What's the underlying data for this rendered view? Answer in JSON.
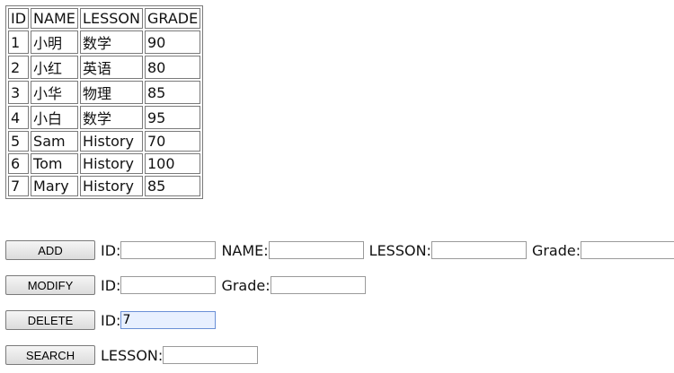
{
  "table": {
    "headers": [
      "ID",
      "NAME",
      "LESSON",
      "GRADE"
    ],
    "rows": [
      [
        "1",
        "小明",
        "数学",
        "90"
      ],
      [
        "2",
        "小红",
        "英语",
        "80"
      ],
      [
        "3",
        "小华",
        "物理",
        "85"
      ],
      [
        "4",
        "小白",
        "数学",
        "95"
      ],
      [
        "5",
        "Sam",
        "History",
        "70"
      ],
      [
        "6",
        "Tom",
        "History",
        "100"
      ],
      [
        "7",
        "Mary",
        "History",
        "85"
      ]
    ]
  },
  "forms": {
    "add": {
      "button": "ADD",
      "id_label": "ID:",
      "name_label": "NAME:",
      "lesson_label": "LESSON:",
      "grade_label": "Grade:",
      "id_value": "",
      "name_value": "",
      "lesson_value": "",
      "grade_value": ""
    },
    "modify": {
      "button": "MODIFY",
      "id_label": "ID:",
      "grade_label": "Grade:",
      "id_value": "",
      "grade_value": ""
    },
    "delete": {
      "button": "DELETE",
      "id_label": "ID:",
      "id_value": "7"
    },
    "search": {
      "button": "SEARCH",
      "lesson_label": "LESSON:",
      "lesson_value": ""
    }
  }
}
